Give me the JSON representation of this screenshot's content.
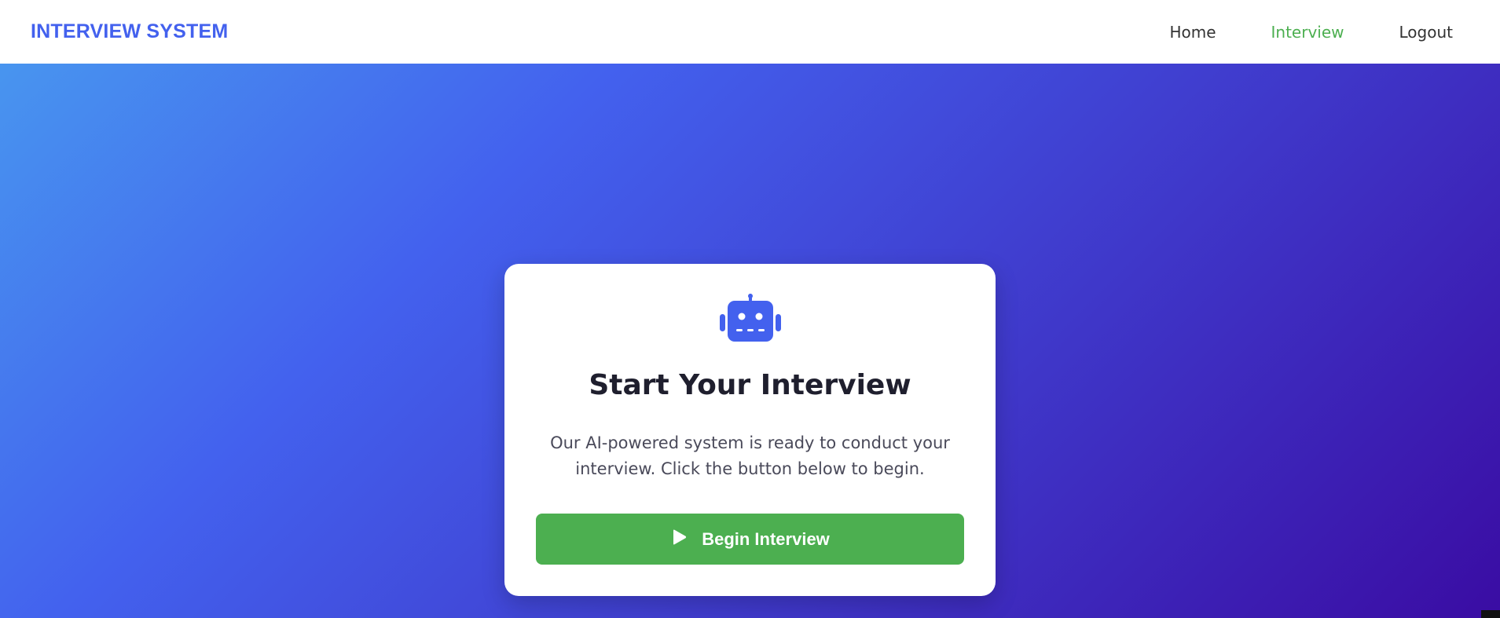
{
  "brand": {
    "title": "INTERVIEW SYSTEM"
  },
  "nav": {
    "items": [
      {
        "label": "Home",
        "active": false
      },
      {
        "label": "Interview",
        "active": true
      },
      {
        "label": "Logout",
        "active": false
      }
    ]
  },
  "card": {
    "icon": "robot-icon",
    "title": "Start Your Interview",
    "description": "Our AI-powered system is ready to conduct your interview. Click the button below to begin.",
    "button_label": "Begin Interview",
    "button_icon": "play-icon"
  },
  "colors": {
    "brand": "#4361ee",
    "active_nav": "#4caf50",
    "button": "#4caf50",
    "gradient_start": "#4895ef",
    "gradient_end": "#3a0ca3"
  }
}
